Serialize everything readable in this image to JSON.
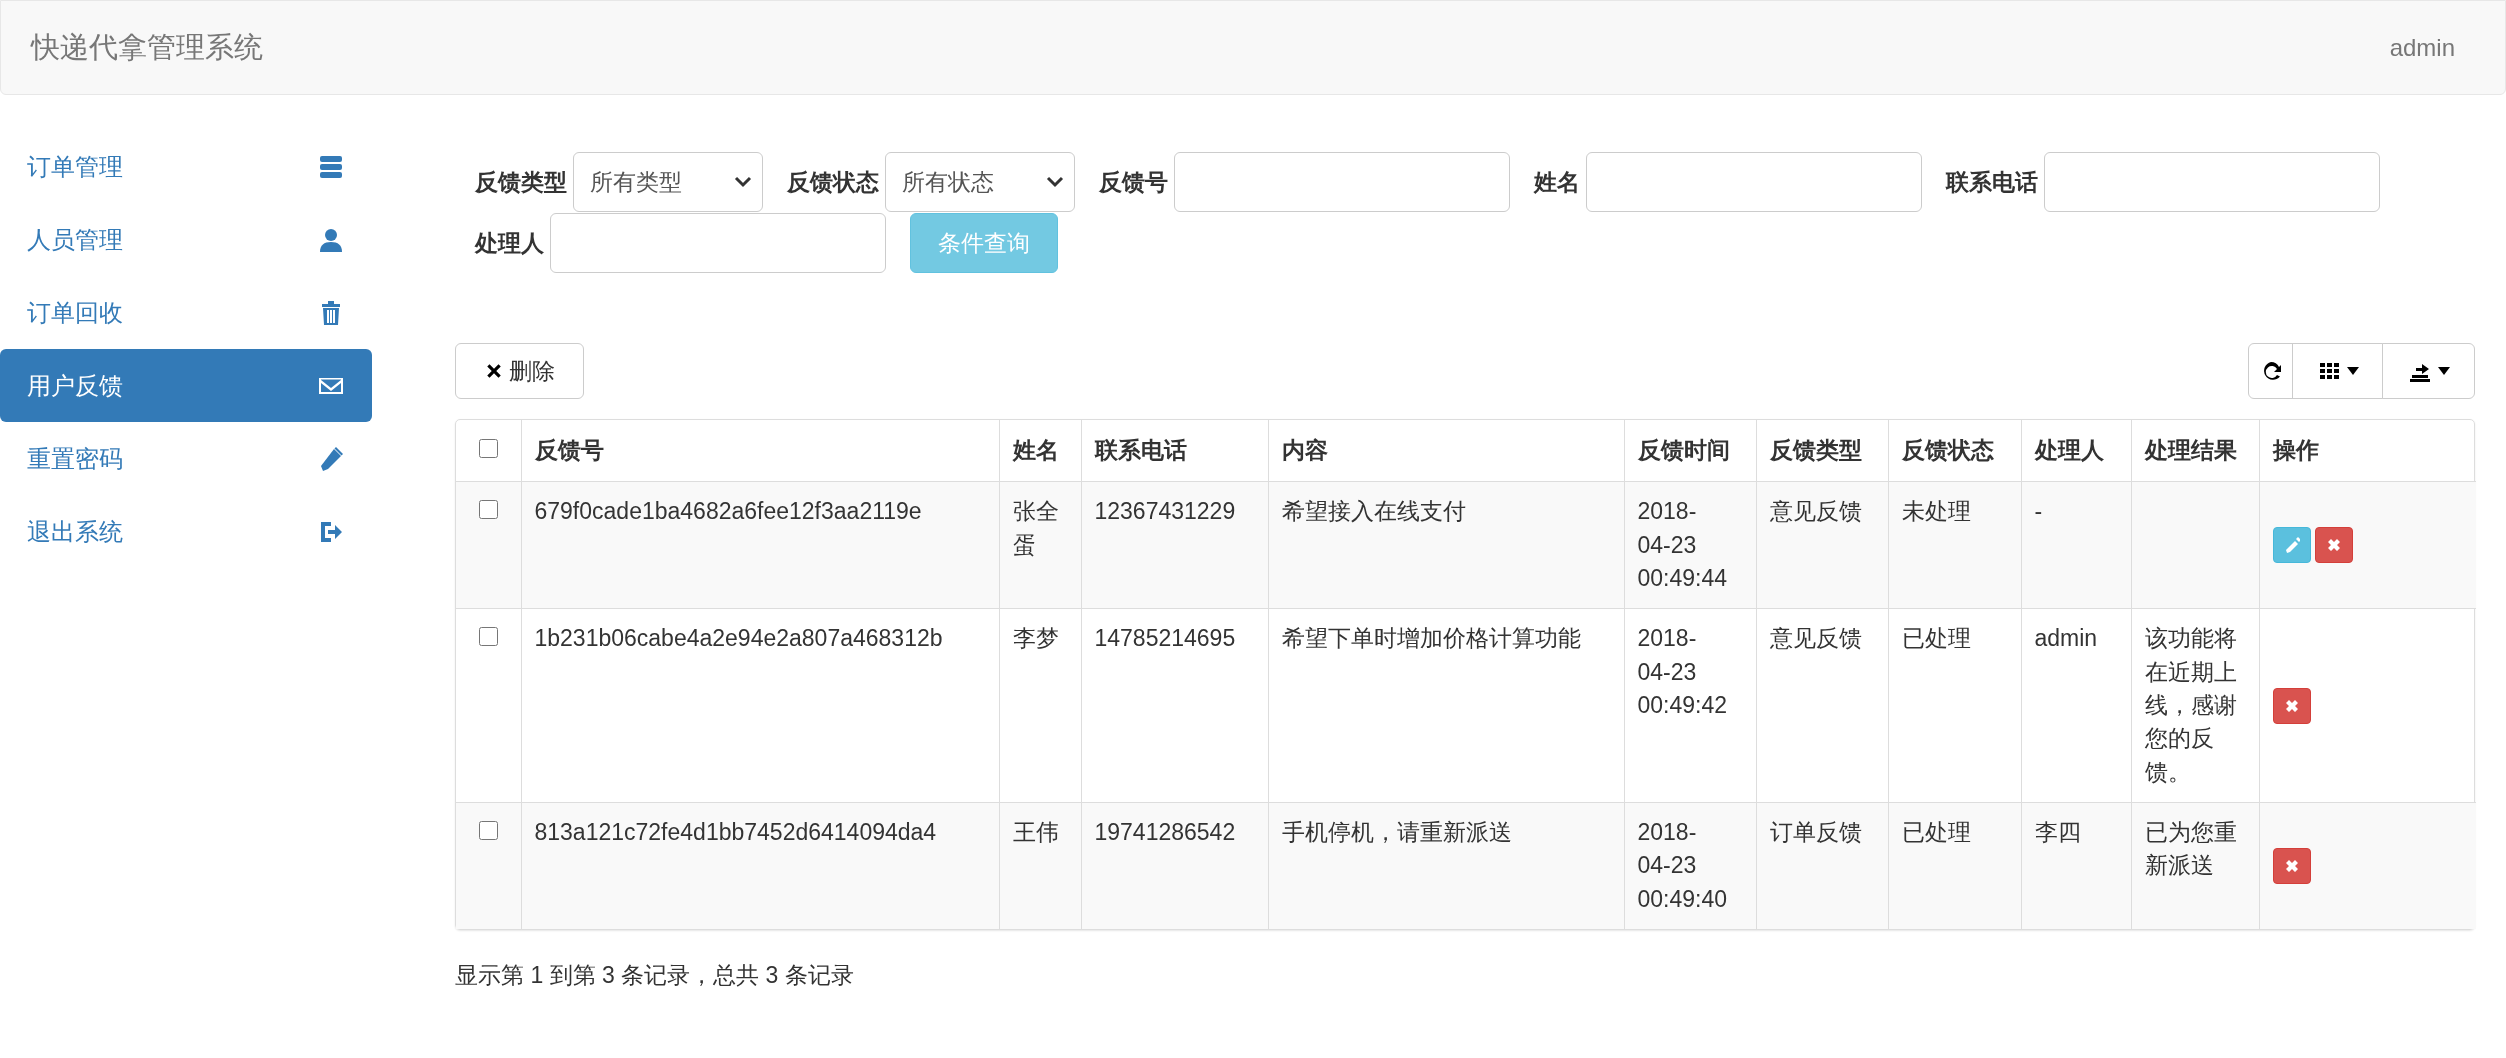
{
  "navbar": {
    "brand": "快递代拿管理系统",
    "user": "admin"
  },
  "sidebar": {
    "items": [
      {
        "label": "订单管理",
        "selected": false
      },
      {
        "label": "人员管理",
        "selected": false
      },
      {
        "label": "订单回收",
        "selected": false
      },
      {
        "label": "用户反馈",
        "selected": true
      },
      {
        "label": "重置密码",
        "selected": false
      },
      {
        "label": "退出系统",
        "selected": false
      }
    ]
  },
  "filters": [
    {
      "kind": "select",
      "label": "反馈类型",
      "value": "所有类型"
    },
    {
      "kind": "select",
      "label": "反馈状态",
      "value": "所有状态"
    },
    {
      "kind": "input",
      "label": "反馈号"
    },
    {
      "kind": "input",
      "label": "姓名"
    },
    {
      "kind": "input",
      "label": "联系电话"
    },
    {
      "kind": "input",
      "label": "处理人"
    }
  ],
  "search_button": "条件查询",
  "toolbar": {
    "delete_button": "删除"
  },
  "table": {
    "header_checked": false,
    "columns": [
      "反馈号",
      "姓名",
      "联系电话",
      "内容",
      "反馈时间",
      "反馈类型",
      "反馈状态",
      "处理人",
      "处理结果",
      "操作"
    ],
    "rows": [
      {
        "checked": false,
        "cells": [
          "679f0cade1ba4682a6fee12f3aa2119e",
          "张全蛋",
          "12367431229",
          "希望接入在线支付",
          "2018-04-23 00:49:44",
          "意见反馈",
          "未处理",
          "-",
          ""
        ],
        "editable": true
      },
      {
        "checked": false,
        "cells": [
          "1b231b06cabe4a2e94e2a807a468312b",
          "李梦",
          "14785214695",
          "希望下单时增加价格计算功能",
          "2018-04-23 00:49:42",
          "意见反馈",
          "已处理",
          "admin",
          "该功能将在近期上线，感谢您的反馈。"
        ],
        "editable": false
      },
      {
        "checked": false,
        "cells": [
          "813a121c72fe4d1bb7452d6414094da4",
          "王伟",
          "19741286542",
          "手机停机，请重新派送",
          "2018-04-23 00:49:40",
          "订单反馈",
          "已处理",
          "李四",
          "已为您重新派送"
        ],
        "editable": false
      }
    ]
  },
  "footer": "显示第 1 到第 3 条记录，总共 3 条记录"
}
